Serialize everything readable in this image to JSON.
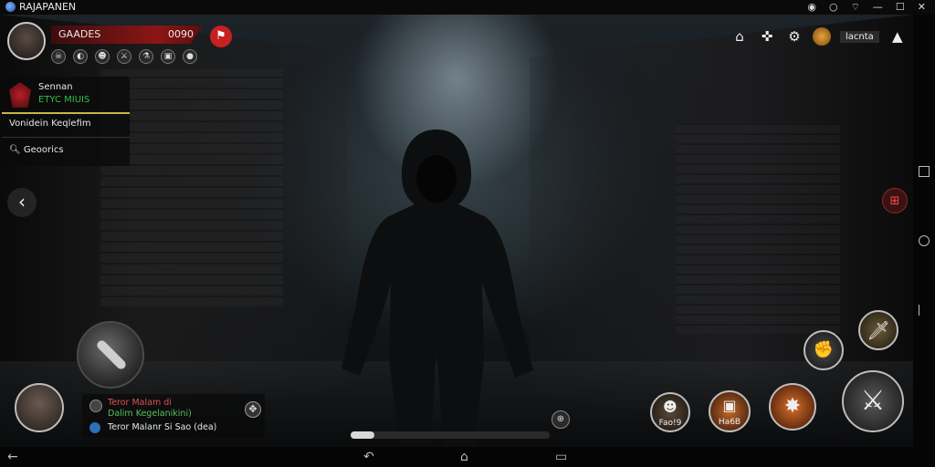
{
  "window": {
    "title": "RAJAPANEN"
  },
  "system_icons": [
    "record-icon",
    "chat-bubble-icon",
    "wifi-icon",
    "minimize-icon",
    "maximize-icon",
    "close-icon"
  ],
  "player": {
    "name": "GAADES",
    "power": "0090",
    "status_icons": [
      "skull-icon",
      "mask-icon",
      "face-icon",
      "sword-icon",
      "flask-icon",
      "chest-icon",
      "coin-icon"
    ]
  },
  "quest": {
    "title": "Sennan",
    "subtitle": "ETYC MIUIS",
    "objective": "Vonidein Keqlefim",
    "search": "Geoorics"
  },
  "top_right": {
    "label": "lacnta"
  },
  "chat": {
    "line1": "Teror Malam di",
    "line2": "Dalim Kegelanikini)",
    "line3": "Teror Malanr Si Sao (dea)"
  },
  "progress": {
    "value": 0.12
  },
  "skills": {
    "s1": "Fao!9",
    "s2": "Ha6B"
  },
  "colors": {
    "accent_red": "#c82020",
    "quest_green": "#2ec04a",
    "chat_red": "#e25050",
    "chat_green": "#58c060"
  }
}
